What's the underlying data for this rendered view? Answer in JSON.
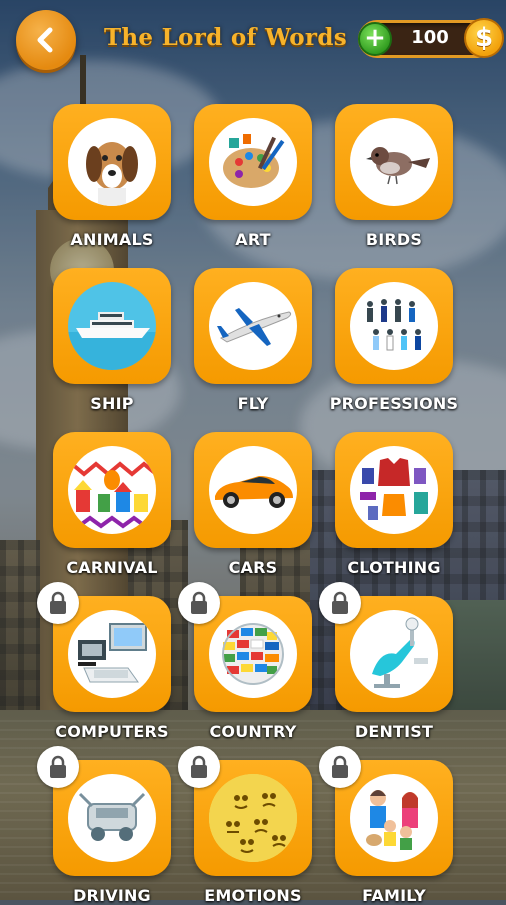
{
  "header": {
    "title": "The Lord of Words",
    "coins": "100",
    "back_icon": "back-arrow-icon",
    "plus_icon": "plus-icon",
    "coin_icon": "dollar-coin-icon"
  },
  "colors": {
    "accent": "#f59a00",
    "title": "#f7b32b",
    "plus_green": "#2f9a1e",
    "coin_gold": "#ffd54a"
  },
  "categories": [
    {
      "label": "ANIMALS",
      "icon": "dog-icon",
      "locked": false
    },
    {
      "label": "ART",
      "icon": "palette-icon",
      "locked": false
    },
    {
      "label": "BIRDS",
      "icon": "sparrow-icon",
      "locked": false
    },
    {
      "label": "SHIP",
      "icon": "yacht-icon",
      "locked": false
    },
    {
      "label": "FLY",
      "icon": "airplane-icon",
      "locked": false
    },
    {
      "label": "PROFESSIONS",
      "icon": "people-icon",
      "locked": false
    },
    {
      "label": "CARNIVAL",
      "icon": "carnival-icon",
      "locked": false
    },
    {
      "label": "CARS",
      "icon": "sports-car-icon",
      "locked": false
    },
    {
      "label": "CLOTHING",
      "icon": "clothes-icon",
      "locked": false
    },
    {
      "label": "COMPUTERS",
      "icon": "computer-icon",
      "locked": true
    },
    {
      "label": "COUNTRY",
      "icon": "flags-globe-icon",
      "locked": true
    },
    {
      "label": "DENTIST",
      "icon": "dentist-chair-icon",
      "locked": true
    },
    {
      "label": "DRIVING",
      "icon": "driving-icon",
      "locked": true
    },
    {
      "label": "EMOTIONS",
      "icon": "emoji-faces-icon",
      "locked": true
    },
    {
      "label": "FAMILY",
      "icon": "family-icon",
      "locked": true
    }
  ]
}
